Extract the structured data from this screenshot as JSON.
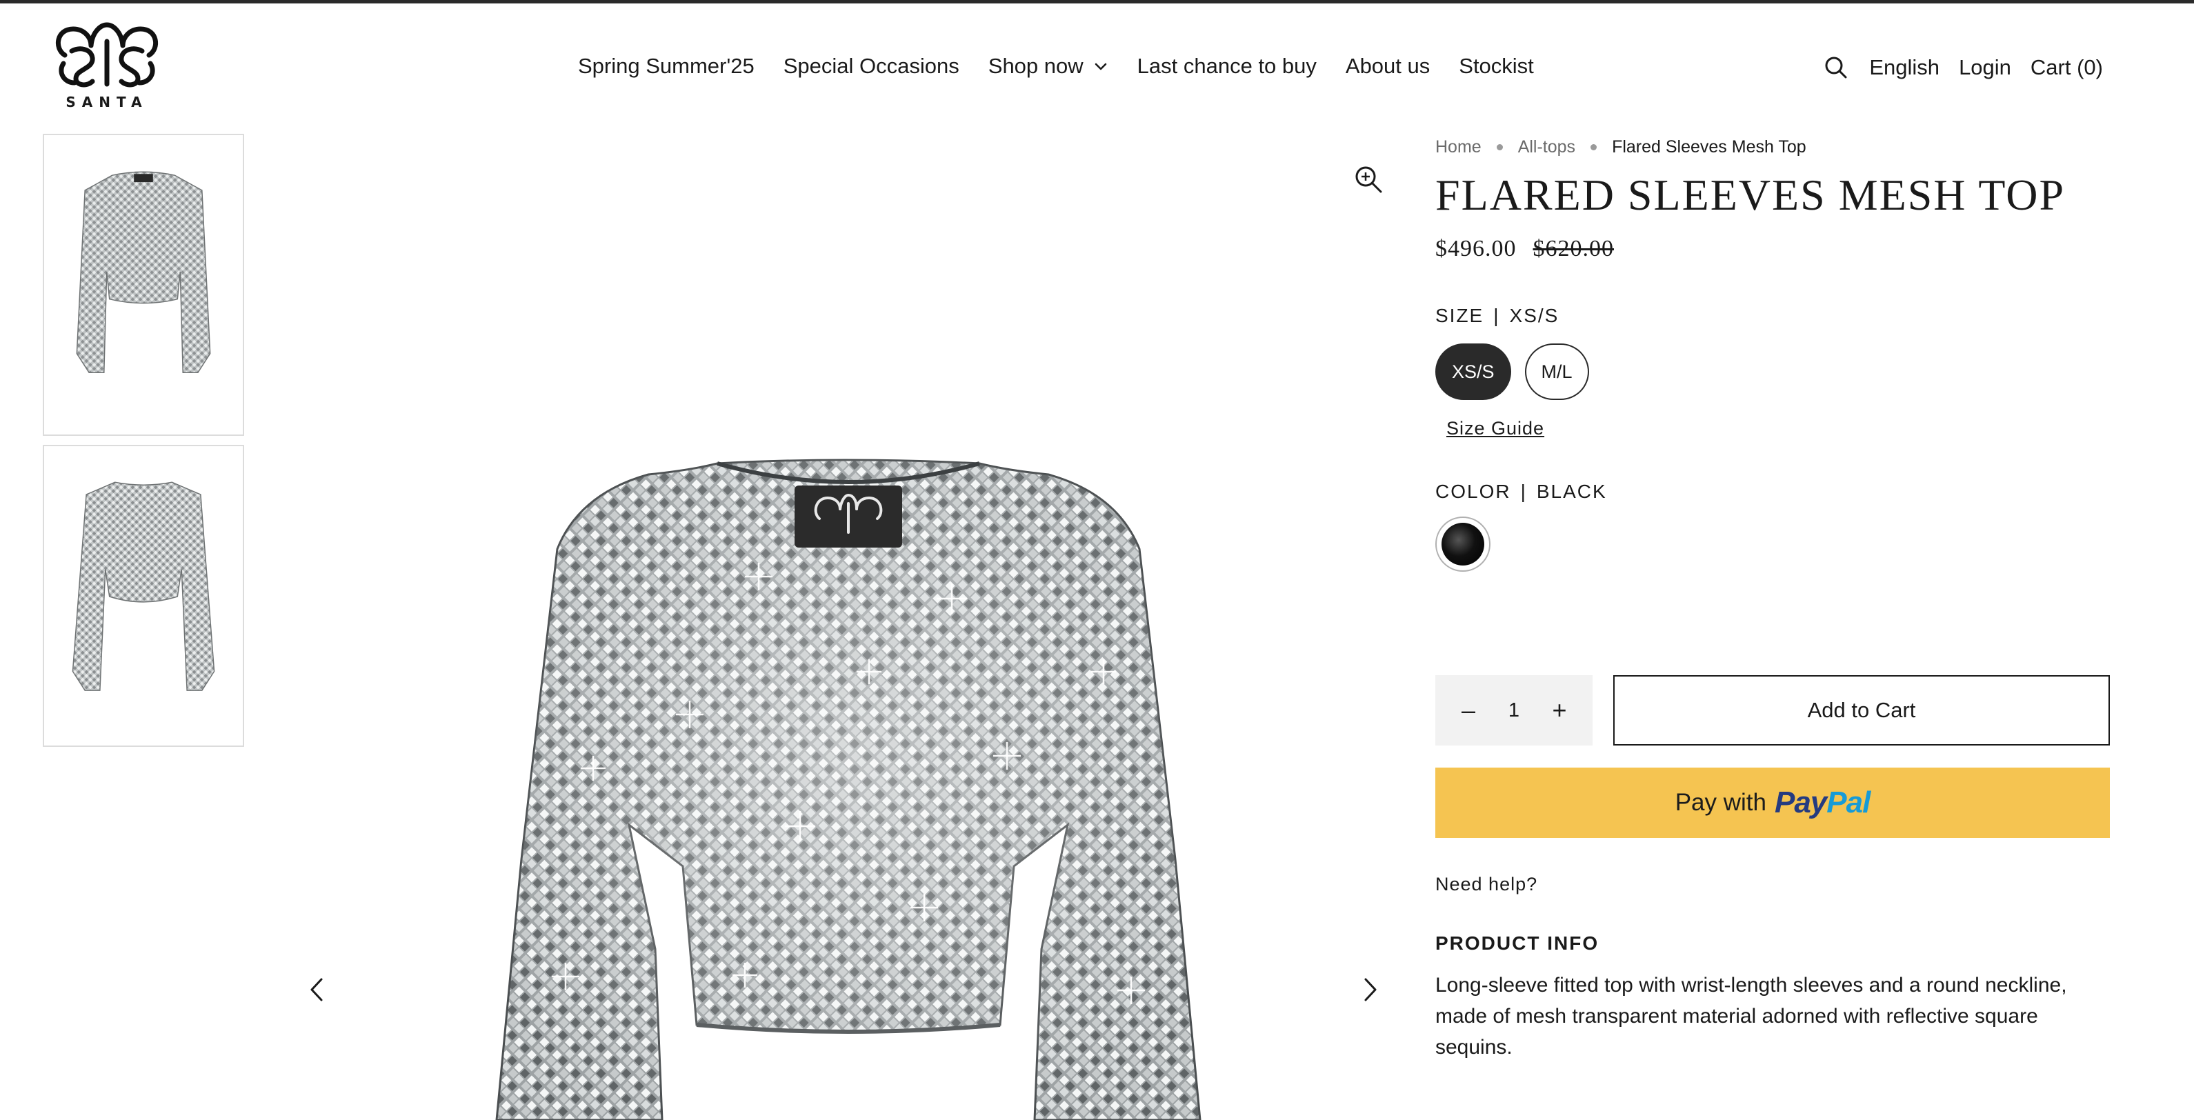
{
  "brand": {
    "logo_text": "SANTA"
  },
  "nav": {
    "items": [
      {
        "label": "Spring Summer'25"
      },
      {
        "label": "Special Occasions"
      },
      {
        "label": "Shop now"
      },
      {
        "label": "Last chance to buy"
      },
      {
        "label": "About us"
      },
      {
        "label": "Stockist"
      }
    ]
  },
  "utility": {
    "language": "English",
    "login": "Login",
    "cart": "Cart (0)"
  },
  "breadcrumb": {
    "home": "Home",
    "category": "All-tops",
    "current": "Flared Sleeves Mesh Top"
  },
  "product": {
    "title": "FLARED SLEEVES MESH TOP",
    "price": "$496.00",
    "compare_price": "$620.00",
    "size": {
      "label": "SIZE",
      "separator": "|",
      "selected": "XS/S",
      "options": [
        "XS/S",
        "M/L"
      ]
    },
    "size_guide": "Size Guide",
    "color": {
      "label": "COLOR",
      "separator": "|",
      "selected": "BLACK",
      "swatch_color": "#000000"
    },
    "quantity": {
      "value": "1",
      "minus": "–",
      "plus": "+"
    },
    "add_to_cart": "Add to Cart",
    "paypal": {
      "prefix": "Pay with",
      "brand_pay": "Pay",
      "brand_pal": "Pal",
      "color": "#f5c451"
    },
    "need_help": "Need help?",
    "info_heading": "PRODUCT INFO",
    "info_text": "Long-sleeve fitted top with wrist-length sleeves and a round neckline, made of mesh transparent material adorned with reflective square sequins."
  }
}
